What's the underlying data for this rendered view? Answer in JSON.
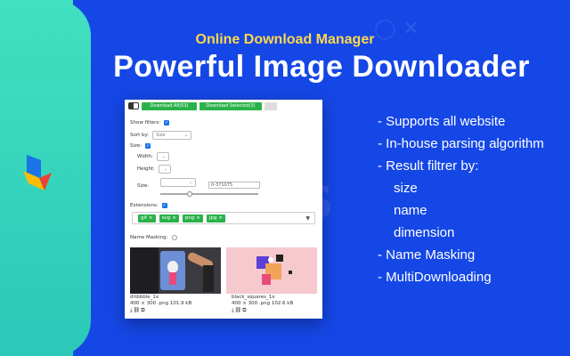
{
  "header": {
    "subtitle": "Online Download Manager",
    "title": "Powerful Image Downloader"
  },
  "panel": {
    "download_all_label": "Download All(53)",
    "download_selected_label": "Download Selected(3)",
    "show_filters_label": "Show filters:",
    "sort_by_label": "Sort by:",
    "sort_by_value": "Size",
    "size_label": "Size:",
    "width_label": "Width:",
    "height_label": "Height:",
    "size_field_label": "Size:",
    "size_range_value": "0-371075",
    "size_slider_value": 0.3,
    "extensions_label": "Extensions:",
    "extensions": [
      "gif",
      "svg",
      "png",
      "jpg"
    ],
    "name_masking_label": "Name Masking:",
    "images": [
      {
        "name": "dribbble_1x",
        "info": "400 × 300 .png 101.9 kB"
      },
      {
        "name": "black_squares_1x",
        "info": "400 × 300 .png 102.6 kB"
      }
    ]
  },
  "features": [
    "- Supports all website",
    "- In-house parsing algorithm",
    "- Result filtrer by:",
    "size",
    "name",
    "dimension",
    "- Name Masking",
    "- MultiDownloading"
  ],
  "colors": {
    "background": "#1547e6",
    "accent_yellow": "#ffd84a",
    "strip": "#41e0c0",
    "button_green": "#2ab24a"
  }
}
